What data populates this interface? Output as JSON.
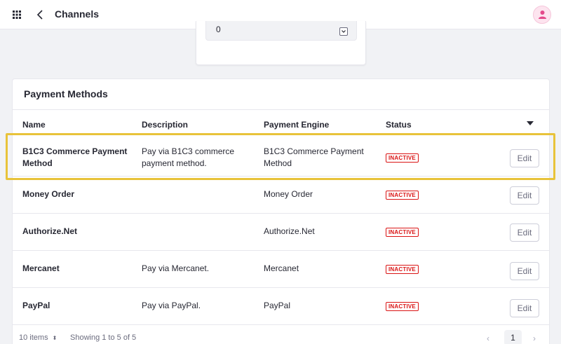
{
  "header": {
    "title": "Channels"
  },
  "upper_card": {
    "select_value": "0"
  },
  "payment_methods": {
    "title": "Payment Methods",
    "columns": [
      "Name",
      "Description",
      "Payment Engine",
      "Status"
    ],
    "rows": [
      {
        "name": "B1C3 Commerce Payment Method",
        "description": "Pay via B1C3 commerce payment method.",
        "engine": "B1C3 Commerce Payment Method",
        "status": "INACTIVE",
        "action": "Edit"
      },
      {
        "name": "Money Order",
        "description": "",
        "engine": "Money Order",
        "status": "INACTIVE",
        "action": "Edit"
      },
      {
        "name": "Authorize.Net",
        "description": "",
        "engine": "Authorize.Net",
        "status": "INACTIVE",
        "action": "Edit"
      },
      {
        "name": "Mercanet",
        "description": "Pay via Mercanet.",
        "engine": "Mercanet",
        "status": "INACTIVE",
        "action": "Edit"
      },
      {
        "name": "PayPal",
        "description": "Pay via PayPal.",
        "engine": "PayPal",
        "status": "INACTIVE",
        "action": "Edit"
      }
    ]
  },
  "pagination": {
    "per_page": "10 items",
    "showing": "Showing 1 to 5 of 5",
    "current_page": "1"
  },
  "colors": {
    "highlight": "#e8c33a",
    "inactive": "#da1414",
    "avatar": "#e44a8b"
  }
}
